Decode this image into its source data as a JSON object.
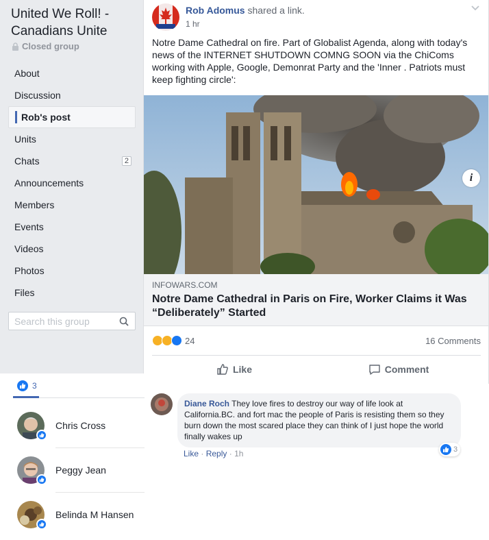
{
  "group": {
    "title": "United We Roll! - Canadians Unite",
    "privacy": "Closed group"
  },
  "sidebar": {
    "items": [
      {
        "label": "About"
      },
      {
        "label": "Discussion"
      },
      {
        "label": "Rob's post",
        "active": true
      },
      {
        "label": "Units"
      },
      {
        "label": "Chats",
        "badge": "2"
      },
      {
        "label": "Announcements"
      },
      {
        "label": "Members"
      },
      {
        "label": "Events"
      },
      {
        "label": "Videos"
      },
      {
        "label": "Photos"
      },
      {
        "label": "Files"
      }
    ],
    "search_placeholder": "Search this group"
  },
  "post": {
    "author": "Rob Adomus",
    "action": "shared a link.",
    "time": "1 hr",
    "text": "Notre Dame Cathedral on fire. Part of Globalist Agenda, along with today's news of the INTERNET SHUTDOWN COMNG SOON via the ChiComs working with Apple, Google, Demonrat Party and the 'Inner . Patriots must keep fighting circle':",
    "link": {
      "domain": "INFOWARS.COM",
      "title": "Notre Dame Cathedral in Paris on Fire, Worker Claims it Was “Deliberately” Started"
    },
    "reactions_count": "24",
    "comments_count": "16 Comments",
    "like_label": "Like",
    "comment_label": "Comment"
  },
  "comment": {
    "author": "Diane Roch",
    "text": "They love fires to destroy our way of life look at California.BC. and fort mac the people of Paris is resisting them so they burn down the most scared place they can think of I just hope the world finally wakes up",
    "reaction_count": "3",
    "like_label": "Like",
    "reply_label": "Reply",
    "time": "1h"
  },
  "reactions_overlay": {
    "tab_count": "3",
    "people": [
      {
        "name": "Chris Cross"
      },
      {
        "name": "Peggy Jean"
      },
      {
        "name": "Belinda M Hansen"
      }
    ]
  },
  "colors": {
    "link_blue": "#365899",
    "like_blue": "#1877f2",
    "sidebar_bg": "#e9ebee"
  }
}
